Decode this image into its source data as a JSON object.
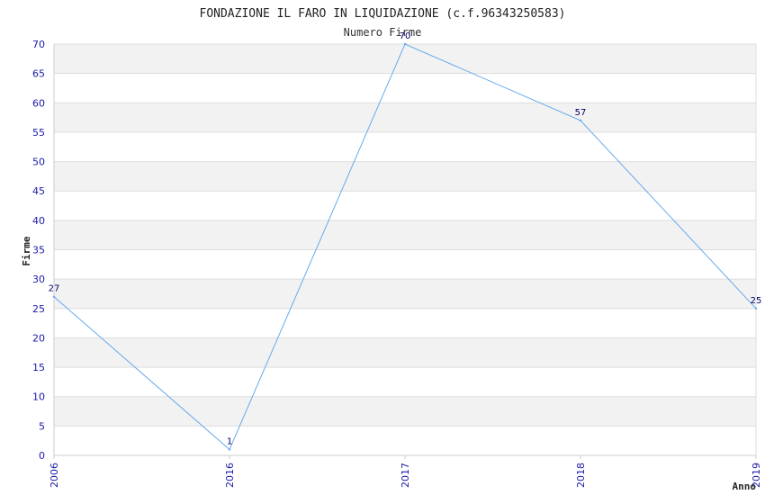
{
  "chart_data": {
    "type": "line",
    "title": "FONDAZIONE IL FARO IN LIQUIDAZIONE (c.f.96343250583)",
    "subtitle": "Numero Firme",
    "xlabel": "Anno",
    "ylabel": "Firme",
    "categories": [
      "2006",
      "2016",
      "2017",
      "2018",
      "2019"
    ],
    "series": [
      {
        "values": [
          27,
          1,
          70,
          57,
          25
        ]
      }
    ],
    "ylim": [
      0,
      70
    ],
    "yticks": [
      0,
      5,
      10,
      15,
      20,
      25,
      30,
      35,
      40,
      45,
      50,
      55,
      60,
      65,
      70
    ],
    "grid": true,
    "colors": {
      "line": "#66aaee",
      "band": "#f2f2f2",
      "gridline": "#dddddd",
      "tick_text": "#1a1aaa",
      "data_label": "#000066"
    }
  }
}
